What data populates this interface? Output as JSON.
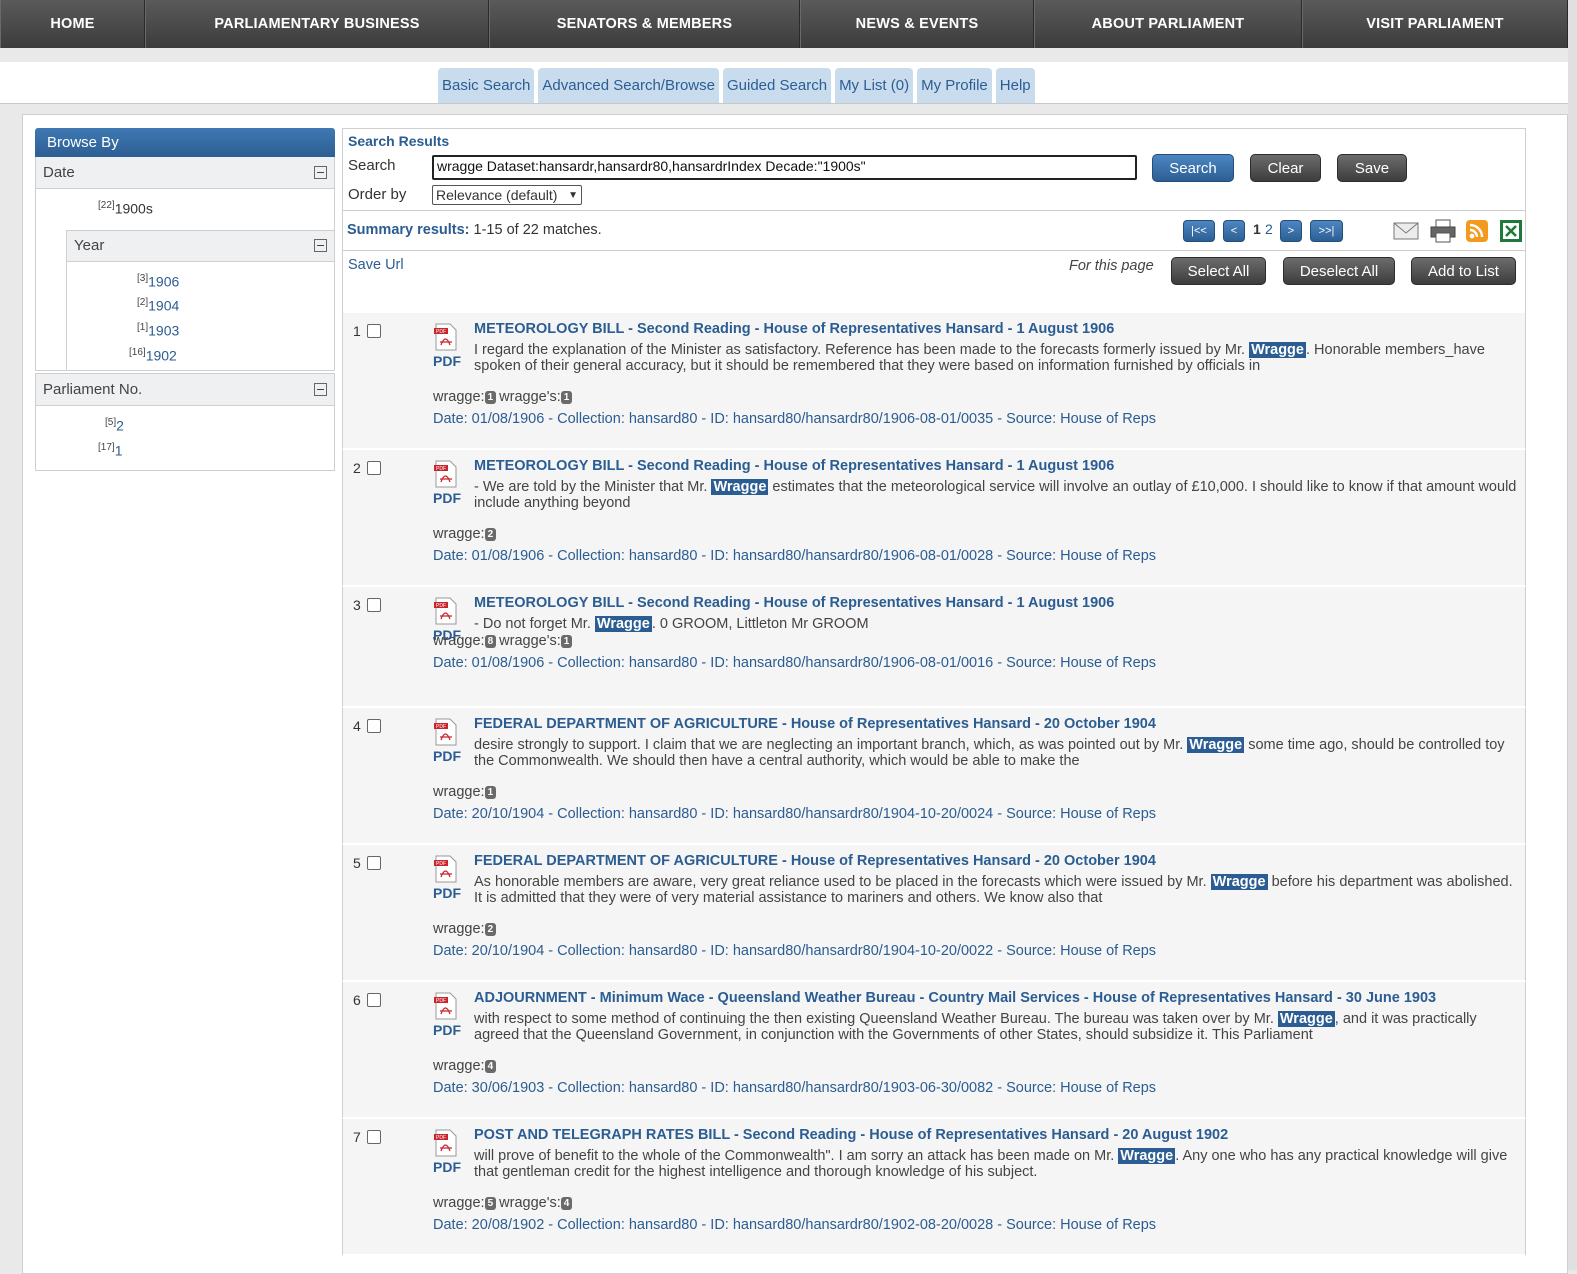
{
  "topnav": [
    "HOME",
    "PARLIAMENTARY BUSINESS",
    "SENATORS & MEMBERS",
    "NEWS & EVENTS",
    "ABOUT PARLIAMENT",
    "VISIT PARLIAMENT"
  ],
  "tabs": [
    "Basic Search",
    "Advanced Search/Browse",
    "Guided Search",
    "My List (0)",
    "My Profile",
    "Help"
  ],
  "sidebar": {
    "title": "Browse By",
    "date_label": "Date",
    "date_items": [
      {
        "count": "[22]",
        "label": "1900s"
      }
    ],
    "year_label": "Year",
    "year_items": [
      {
        "count": "[3]",
        "label": "1906"
      },
      {
        "count": "[2]",
        "label": "1904"
      },
      {
        "count": "[1]",
        "label": "1903"
      },
      {
        "count": "[16]",
        "label": "1902"
      }
    ],
    "parliament_label": "Parliament No.",
    "parliament_items": [
      {
        "count": "[5]",
        "label": "2"
      },
      {
        "count": "[17]",
        "label": "1"
      }
    ]
  },
  "search": {
    "results_title": "Search Results",
    "search_label": "Search",
    "query": "wragge Dataset:hansardr,hansardr80,hansardrIndex Decade:\"1900s\"",
    "order_label": "Order by",
    "order_value": "Relevance (default)",
    "search_btn": "Search",
    "clear_btn": "Clear",
    "save_btn": "Save"
  },
  "summary": {
    "label": "Summary results:",
    "text": "1-15 of 22 matches.",
    "first": "|<<",
    "prev": "<",
    "page_current": "1",
    "page_other": "2",
    "next": ">",
    "last": ">>|"
  },
  "actions": {
    "save_url": "Save Url",
    "for_page": "For this page",
    "select_all": "Select All",
    "deselect_all": "Deselect All",
    "add_to_list": "Add to List"
  },
  "pdf_label": "PDF",
  "results": [
    {
      "num": "1",
      "title": "METEOROLOGY BILL - Second Reading - House of Representatives Hansard - 1 August 1906",
      "pre": "I regard the explanation of the Minister as satisfactory. Reference has been made to the forecasts formerly issued by Mr. ",
      "hl": "Wragge",
      "post": ". Honorable members_have spoken of their general accuracy, but it should be remembered that they were based on information furnished by officials in",
      "terms": [
        {
          "t": "wragge:",
          "n": "1"
        },
        {
          "t": "wragge's:",
          "n": "1"
        }
      ],
      "meta": "Date: 01/08/1906 - Collection: hansard80 - ID: hansard80/hansardr80/1906-08-01/0035 - Source: House of Reps"
    },
    {
      "num": "2",
      "title": "METEOROLOGY BILL - Second Reading - House of Representatives Hansard - 1 August 1906",
      "pre": "- We are told by the Minister that Mr. ",
      "hl": "Wragge",
      "post": " estimates that the meteorological service will involve an outlay of £10,000. I should like to know if that amount would include anything beyond",
      "terms": [
        {
          "t": "wragge:",
          "n": "2"
        }
      ],
      "meta": "Date: 01/08/1906 - Collection: hansard80 - ID: hansard80/hansardr80/1906-08-01/0028 - Source: House of Reps"
    },
    {
      "num": "3",
      "title": "METEOROLOGY BILL - Second Reading - House of Representatives Hansard - 1 August 1906",
      "pre": "- Do not forget Mr. ",
      "hl": "Wragge",
      "post": ". 0 GROOM, Littleton Mr GROOM",
      "terms": [
        {
          "t": "wragge:",
          "n": "8"
        },
        {
          "t": "wragge's:",
          "n": "1"
        }
      ],
      "meta": "Date: 01/08/1906 - Collection: hansard80 - ID: hansard80/hansardr80/1906-08-01/0016 - Source: House of Reps"
    },
    {
      "num": "4",
      "title": "FEDERAL DEPARTMENT OF AGRICULTURE - House of Representatives Hansard - 20 October 1904",
      "pre": "desire strongly to support. I claim that we are neglecting an important branch, which, as was pointed out by Mr. ",
      "hl": "Wragge",
      "post": " some time ago, should be controlled toy the Commonwealth. We should then have a central authority, which would be able to make the",
      "terms": [
        {
          "t": "wragge:",
          "n": "1"
        }
      ],
      "meta": "Date: 20/10/1904 - Collection: hansard80 - ID: hansard80/hansardr80/1904-10-20/0024 - Source: House of Reps"
    },
    {
      "num": "5",
      "title": "FEDERAL DEPARTMENT OF AGRICULTURE - House of Representatives Hansard - 20 October 1904",
      "pre": "As honorable members are aware, very great reliance used to be placed in the forecasts which were issued by Mr. ",
      "hl": "Wragge",
      "post": " before his department was abolished. It is admitted that they were of very material assistance to mariners and others. We know also that",
      "terms": [
        {
          "t": "wragge:",
          "n": "2"
        }
      ],
      "meta": "Date: 20/10/1904 - Collection: hansard80 - ID: hansard80/hansardr80/1904-10-20/0022 - Source: House of Reps"
    },
    {
      "num": "6",
      "title": "ADJOURNMENT - Minimum Wace - Queensland Weather Bureau - Country Mail Services - House of Representatives Hansard - 30 June 1903",
      "pre": "with respect to some method of continuing the then existing Queensland Weather Bureau. The bureau was taken over by Mr. ",
      "hl": "Wragge",
      "post": ", and it was practically agreed that the Queensland Government, in conjunction with the Governments of other States, should subsidize it. This Parliament",
      "terms": [
        {
          "t": "wragge:",
          "n": "4"
        }
      ],
      "meta": "Date: 30/06/1903 - Collection: hansard80 - ID: hansard80/hansardr80/1903-06-30/0082 - Source: House of Reps"
    },
    {
      "num": "7",
      "title": "POST AND TELEGRAPH RATES BILL - Second Reading - House of Representatives Hansard - 20 August 1902",
      "pre": "will prove of benefit to the whole of the Commonwealth\". I am sorry an attack has been made on Mr. ",
      "hl": "Wragge",
      "post": ". Any one who has any practical knowledge will give that gentleman credit for the highest intelligence and thorough knowledge of his subject.",
      "terms": [
        {
          "t": "wragge:",
          "n": "5"
        },
        {
          "t": "wragge's:",
          "n": "4"
        }
      ],
      "meta": "Date: 20/08/1902 - Collection: hansard80 - ID: hansard80/hansardr80/1902-08-20/0028 - Source: House of Reps"
    }
  ]
}
